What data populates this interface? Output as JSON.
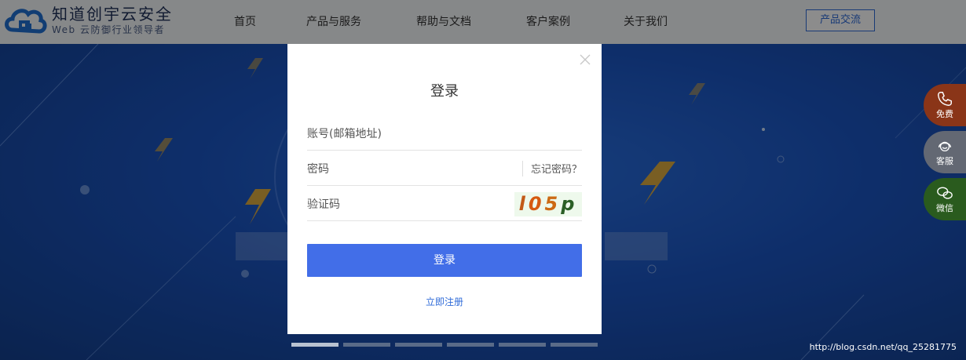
{
  "header": {
    "brand_name": "知道创宇云安全",
    "brand_slogan": "Web 云防御行业领导者",
    "nav": [
      "首页",
      "产品与服务",
      "帮助与文档",
      "客户案例",
      "关于我们"
    ],
    "consult_button": "产品交流"
  },
  "login_modal": {
    "title": "登录",
    "account_placeholder": "账号(邮箱地址)",
    "password_placeholder": "密码",
    "forgot_link": "忘记密码？",
    "captcha_placeholder": "验证码",
    "captcha_chars": [
      "l",
      "0",
      "5",
      "p"
    ],
    "login_button": "登录",
    "register_link": "立即注册"
  },
  "side_float": {
    "items": [
      {
        "label": "免费",
        "icon": "phone-icon",
        "color": "#e8501c"
      },
      {
        "label": "客服",
        "icon": "headset-icon",
        "color": "#aeb5bf"
      },
      {
        "label": "微信",
        "icon": "wechat-icon",
        "color": "#3fa92f"
      }
    ]
  },
  "carousel": {
    "slide_count": 6,
    "active_index": 0
  },
  "watermark": "http://blog.csdn.net/qq_25281775",
  "colors": {
    "accent": "#426ee8",
    "link": "#2f6bd8",
    "banner": "#1b55c2"
  }
}
